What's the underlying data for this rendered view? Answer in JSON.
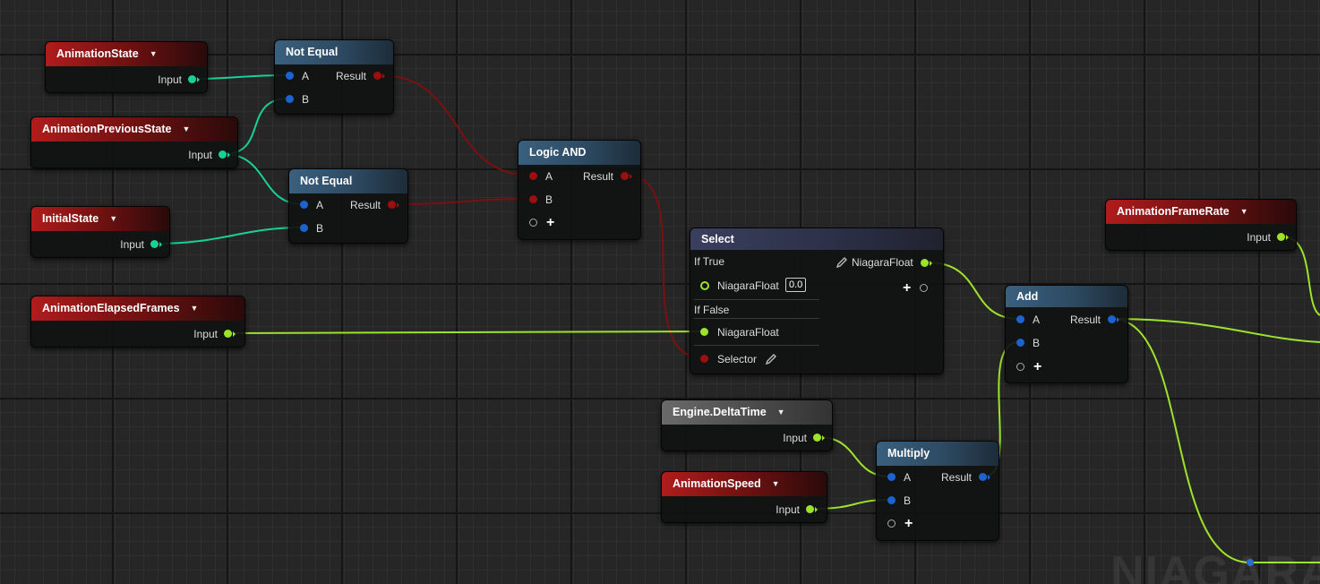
{
  "app": {
    "watermark": "NIAGARA"
  },
  "colors": {
    "float": "#9ee32b",
    "enum": "#17d196",
    "bool": "#9a1010",
    "vector": "#1c63d2",
    "background": "#262626"
  },
  "nodes": {
    "animation_state": {
      "title": "AnimationState",
      "pin": "Input"
    },
    "animation_previous_state": {
      "title": "AnimationPreviousState",
      "pin": "Input"
    },
    "initial_state": {
      "title": "InitialState",
      "pin": "Input"
    },
    "animation_elapsed_frames": {
      "title": "AnimationElapsedFrames",
      "pin": "Input"
    },
    "not_equal_1": {
      "title": "Not Equal",
      "in_a": "A",
      "in_b": "B",
      "out": "Result"
    },
    "not_equal_2": {
      "title": "Not Equal",
      "in_a": "A",
      "in_b": "B",
      "out": "Result"
    },
    "logic_and": {
      "title": "Logic AND",
      "in_a": "A",
      "in_b": "B",
      "out": "Result",
      "add_pin": "+"
    },
    "select": {
      "title": "Select",
      "if_true": "If True",
      "if_true_pin": "NiagaraFloat",
      "if_true_value": "0.0",
      "if_false": "If False",
      "if_false_pin": "NiagaraFloat",
      "selector": "Selector",
      "output": "NiagaraFloat",
      "add_pin": "+"
    },
    "animation_frame_rate": {
      "title": "AnimationFrameRate",
      "pin": "Input"
    },
    "add": {
      "title": "Add",
      "in_a": "A",
      "in_b": "B",
      "out": "Result",
      "add_pin": "+"
    },
    "engine_delta_time": {
      "title": "Engine.DeltaTime",
      "pin": "Input"
    },
    "animation_speed": {
      "title": "AnimationSpeed",
      "pin": "Input"
    },
    "multiply": {
      "title": "Multiply",
      "in_a": "A",
      "in_b": "B",
      "out": "Result",
      "add_pin": "+"
    }
  }
}
